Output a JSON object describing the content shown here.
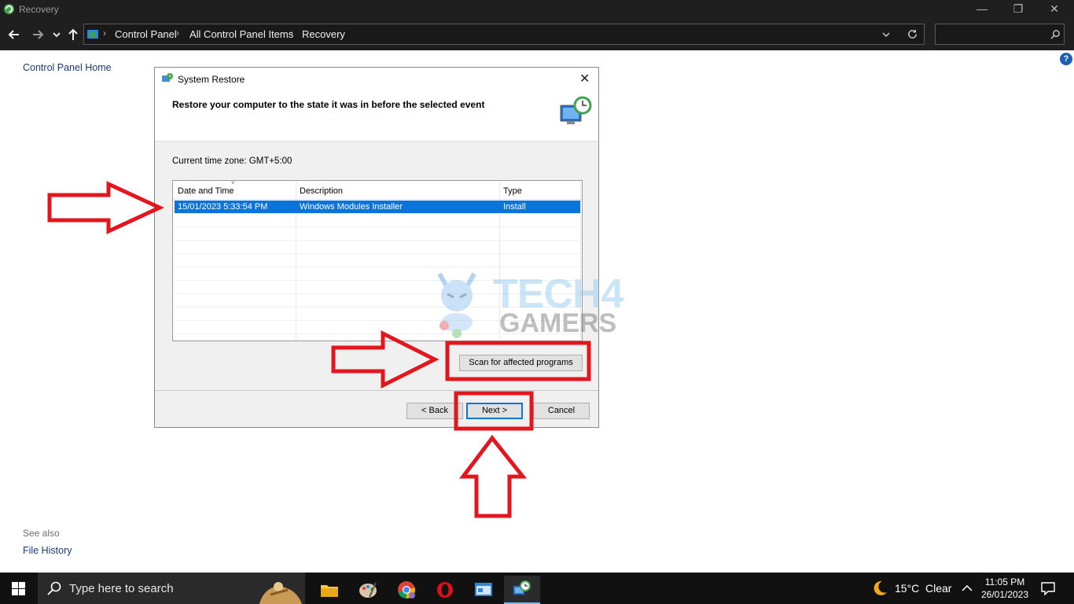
{
  "window": {
    "title": "Recovery",
    "controls": {
      "minimize": "—",
      "maximize": "❐",
      "close": "✕"
    }
  },
  "address": {
    "breadcrumbs": [
      "Control Panel",
      "All Control Panel Items",
      "Recovery"
    ],
    "search_placeholder": ""
  },
  "sidebar": {
    "home_link": "Control Panel Home",
    "see_also": "See also",
    "file_history": "File History",
    "help": "?"
  },
  "dialog": {
    "title": "System Restore",
    "close": "✕",
    "heading": "Restore your computer to the state it was in before the selected event",
    "timezone": "Current time zone: GMT+5:00",
    "columns": [
      "Date and Time",
      "Description",
      "Type"
    ],
    "rows": [
      {
        "date": "15/01/2023 5:33:54 PM",
        "description": "Windows Modules Installer",
        "type": "Install",
        "selected": true
      }
    ],
    "scan_button": "Scan for affected programs",
    "back_button": "< Back",
    "next_button": "Next >",
    "cancel_button": "Cancel"
  },
  "watermark": {
    "line1": "TECH4",
    "line2": "GAMERS"
  },
  "taskbar": {
    "search_placeholder": "Type here to search",
    "weather_temp": "15°C",
    "weather_text": "Clear",
    "time": "11:05 PM",
    "date": "26/01/2023"
  },
  "colors": {
    "annotation": "#e3161e",
    "selection": "#0a74da",
    "dark_chrome": "#1f1f1f"
  }
}
